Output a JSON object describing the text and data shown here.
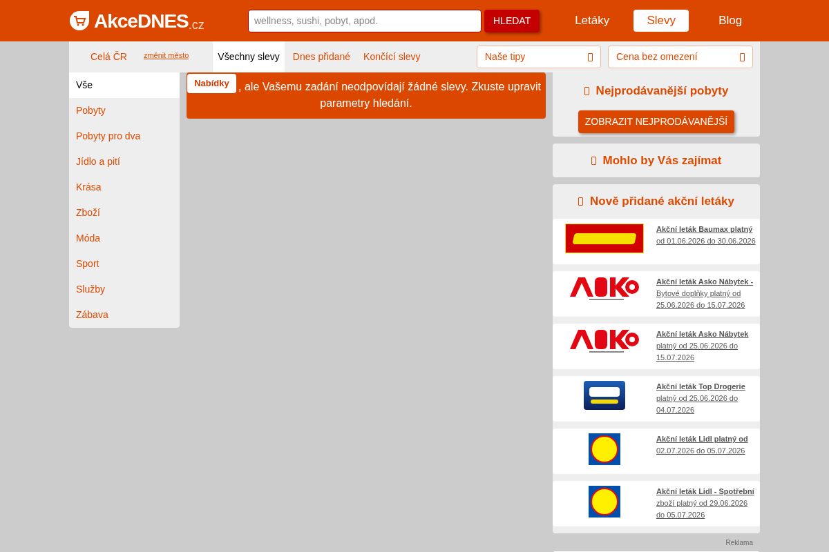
{
  "header": {
    "logo": {
      "name": "AkceDNES",
      "suffix": ".cz"
    },
    "search": {
      "placeholder": "wellness, sushi, pobyt, apod."
    },
    "search_button": "HLEDAT",
    "nav": [
      {
        "label": "Letáky",
        "selected": false
      },
      {
        "label": "Slevy",
        "selected": true
      },
      {
        "label": "Blog",
        "selected": false
      }
    ]
  },
  "subnav": {
    "city": "Celá ČR",
    "change_city": "změnit město",
    "tabs": [
      {
        "label": "Všechny slevy",
        "selected": true
      },
      {
        "label": "Dnes přidané",
        "selected": false
      },
      {
        "label": "Končící slevy",
        "selected": false
      }
    ],
    "selects": [
      {
        "value": "Naše tipy"
      },
      {
        "value": "Cena bez omezení"
      }
    ]
  },
  "categories": [
    {
      "label": "Vše",
      "selected": true
    },
    {
      "label": "Pobyty",
      "selected": false
    },
    {
      "label": "Pobyty pro dva",
      "selected": false
    },
    {
      "label": "Jídlo a pití",
      "selected": false
    },
    {
      "label": "Krása",
      "selected": false
    },
    {
      "label": "Zboží",
      "selected": false
    },
    {
      "label": "Móda",
      "selected": false
    },
    {
      "label": "Sport",
      "selected": false
    },
    {
      "label": "Služby",
      "selected": false
    },
    {
      "label": "Zábava",
      "selected": false
    }
  ],
  "message": {
    "tag": "Nabídky",
    "text": ", ale Vašemu zadání neodpovídají žádné slevy. Zkuste upravit parametry hledání."
  },
  "bestsellers": {
    "title": "Nejprodávanější pobyty",
    "button": "ZOBRAZIT NEJPRODÁVANĚJŠÍ"
  },
  "interesting": {
    "title": "Mohlo by Vás zajímat"
  },
  "leaflets": {
    "title": "Nově přidané akční letáky",
    "items": [
      {
        "kind": "baumax",
        "title": "Akční leták Baumax platný",
        "detail": "od 01.06.2026 do 30.06.2026"
      },
      {
        "kind": "asko",
        "title": "Akční leták Asko Nábytek -",
        "detail": "Bytové doplňky platný od 25.06.2026 do 15.07.2026"
      },
      {
        "kind": "asko",
        "title": "Akční leták Asko Nábytek",
        "detail": "platný od 25.06.2026 do 15.07.2026"
      },
      {
        "kind": "top",
        "title": "Akční leták Top Drogerie",
        "detail": "platný od 25.06.2026 do 04.07.2026"
      },
      {
        "kind": "lidl",
        "title": "Akční leták Lidl platný od",
        "detail": "02.07.2026 do 05.07.2026"
      },
      {
        "kind": "lidl",
        "title": "Akční leták Lidl - Spotřební",
        "detail": "zboží platný od 29.06.2026 do 05.07.2026"
      }
    ]
  },
  "ad_label": "Reklama"
}
